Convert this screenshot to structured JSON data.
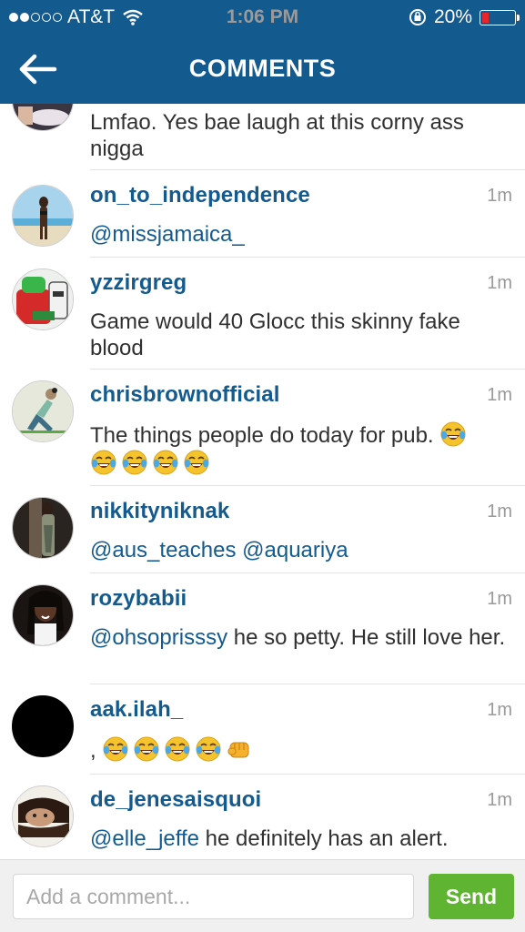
{
  "status_bar": {
    "carrier": "AT&T",
    "time": "1:06 PM",
    "battery": "20%",
    "battery_level": 0.2
  },
  "header": {
    "title": "COMMENTS",
    "back_icon": "back-arrow-icon"
  },
  "comments": [
    {
      "username": "",
      "time": "",
      "text": "Lmfao. Yes bae laugh at this corny ass nigga"
    },
    {
      "username": "on_to_independence",
      "time": "1m",
      "mention": "@missjamaica_",
      "text": ""
    },
    {
      "username": "yzzirgreg",
      "time": "1m",
      "text": "Game would 40 Glocc this skinny fake blood"
    },
    {
      "username": "chrisbrownofficial",
      "time": "1m",
      "text": "The things people do today for pub.",
      "emoji": [
        "face-with-tears-of-joy",
        "face-with-tears-of-joy",
        "face-with-tears-of-joy",
        "face-with-tears-of-joy",
        "face-with-tears-of-joy"
      ]
    },
    {
      "username": "nikkityniknak",
      "time": "1m",
      "mention": "@aus_teaches @aquariya",
      "text": ""
    },
    {
      "username": "rozybabii",
      "time": "1m",
      "mention": "@ohsoprisssy",
      "text": " he so petty. He still love her."
    },
    {
      "username": "aak.ilah_",
      "time": "1m",
      "text": ",",
      "emoji": [
        "face-with-tears-of-joy",
        "face-with-tears-of-joy",
        "face-with-tears-of-joy",
        "face-with-tears-of-joy",
        "fist-bump"
      ]
    },
    {
      "username": "de_jenesaisquoi",
      "time": "1m",
      "mention": "@elle_jeffe",
      "text": " he definitely has an alert."
    }
  ],
  "composer": {
    "placeholder": "Add a comment...",
    "value": "",
    "send_label": "Send"
  },
  "colors": {
    "header": "#135a8f",
    "username": "#135a8f",
    "send": "#5fb431",
    "time": "#9a9a9a"
  }
}
